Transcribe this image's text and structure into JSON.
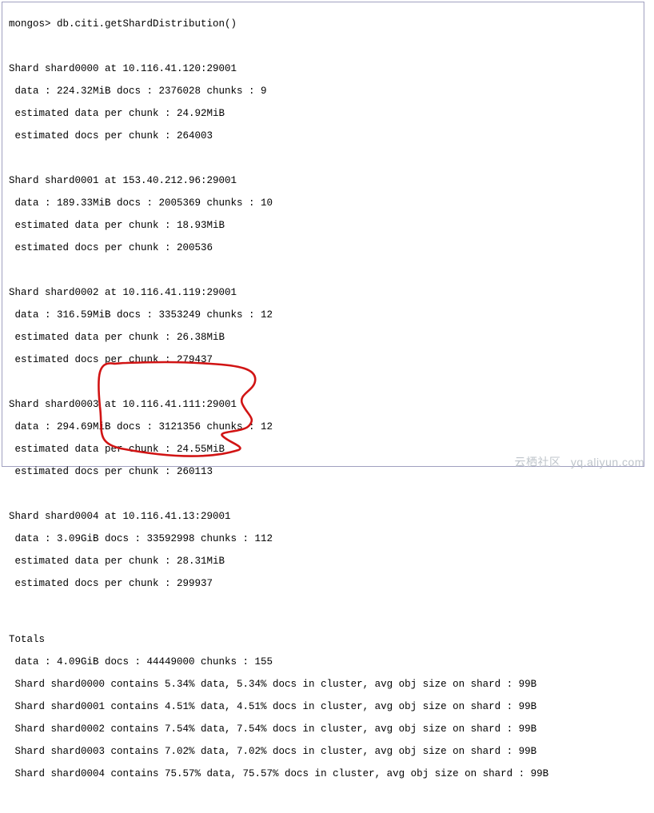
{
  "prompt": "mongos> db.citi.getShardDistribution()",
  "shards": [
    {
      "header": "Shard shard0000 at 10.116.41.120:29001",
      "data": " data : 224.32MiB docs : 2376028 chunks : 9",
      "edpc": " estimated data per chunk : 24.92MiB",
      "eopc": " estimated docs per chunk : 264003"
    },
    {
      "header": "Shard shard0001 at 153.40.212.96:29001",
      "data": " data : 189.33MiB docs : 2005369 chunks : 10",
      "edpc": " estimated data per chunk : 18.93MiB",
      "eopc": " estimated docs per chunk : 200536"
    },
    {
      "header": "Shard shard0002 at 10.116.41.119:29001",
      "data": " data : 316.59MiB docs : 3353249 chunks : 12",
      "edpc": " estimated data per chunk : 26.38MiB",
      "eopc": " estimated docs per chunk : 279437"
    },
    {
      "header": "Shard shard0003 at 10.116.41.111:29001",
      "data": " data : 294.69MiB docs : 3121356 chunks : 12",
      "edpc": " estimated data per chunk : 24.55MiB",
      "eopc": " estimated docs per chunk : 260113"
    },
    {
      "header": "Shard shard0004 at 10.116.41.13:29001",
      "data": " data : 3.09GiB docs : 33592998 chunks : 112",
      "edpc": " estimated data per chunk : 28.31MiB",
      "eopc": " estimated docs per chunk : 299937"
    }
  ],
  "totals": {
    "header": "Totals",
    "data": " data : 4.09GiB docs : 44449000 chunks : 155",
    "lines": [
      " Shard shard0000 contains 5.34% data, 5.34% docs in cluster, avg obj size on shard : 99B",
      " Shard shard0001 contains 4.51% data, 4.51% docs in cluster, avg obj size on shard : 99B",
      " Shard shard0002 contains 7.54% data, 7.54% docs in cluster, avg obj size on shard : 99B",
      " Shard shard0003 contains 7.02% data, 7.02% docs in cluster, avg obj size on shard : 99B",
      " Shard shard0004 contains 75.57% data, 75.57% docs in cluster, avg obj size on shard : 99B"
    ]
  },
  "watermark": {
    "left": "云栖社区",
    "right": "yq.aliyun.com"
  },
  "annotation_color": "#d11414"
}
